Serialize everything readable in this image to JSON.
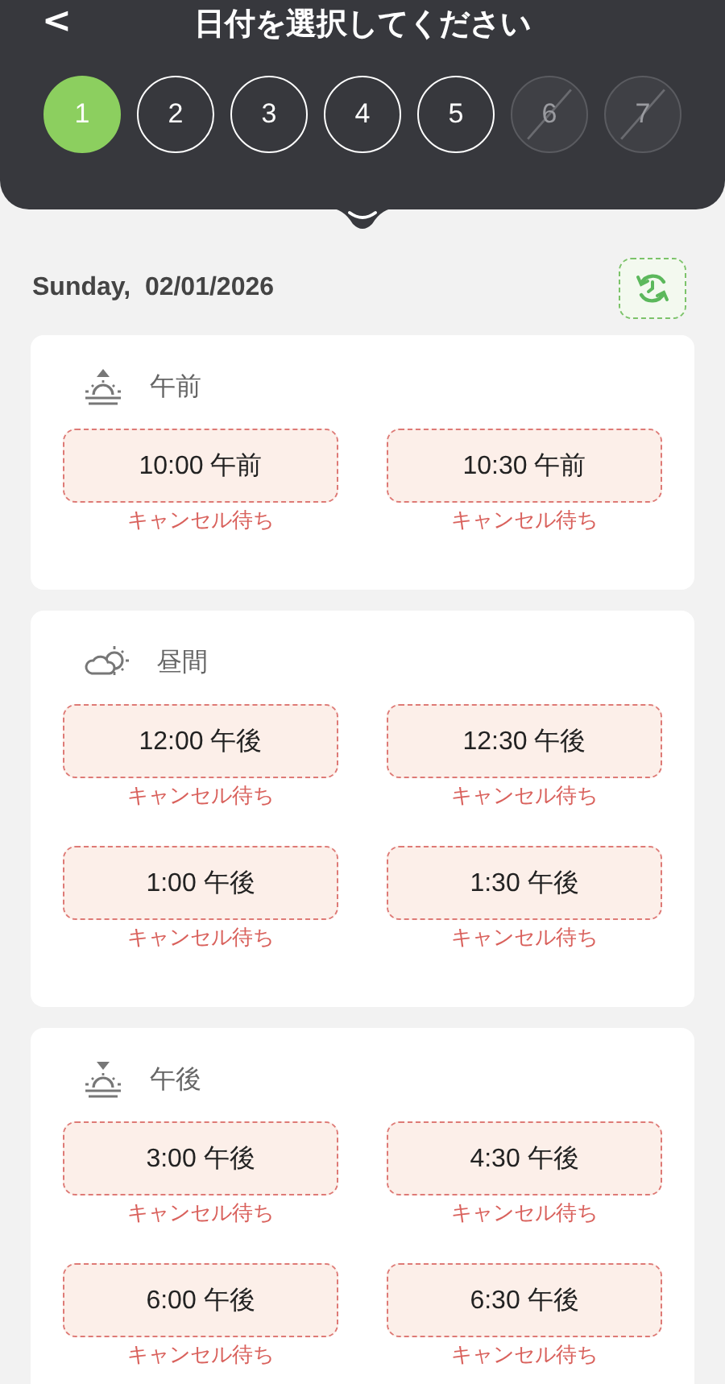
{
  "header": {
    "back": "<",
    "title": "日付を選択してください"
  },
  "days": [
    {
      "label": "1",
      "selected": true,
      "disabled": false
    },
    {
      "label": "2",
      "selected": false,
      "disabled": false
    },
    {
      "label": "3",
      "selected": false,
      "disabled": false
    },
    {
      "label": "4",
      "selected": false,
      "disabled": false
    },
    {
      "label": "5",
      "selected": false,
      "disabled": false
    },
    {
      "label": "6",
      "selected": false,
      "disabled": true
    },
    {
      "label": "7",
      "selected": false,
      "disabled": true
    }
  ],
  "date": "Sunday,  02/01/2026",
  "sections": [
    {
      "kind": "sunrise",
      "title": "午前",
      "slots": [
        {
          "time": "10:00 午前",
          "note": "キャンセル待ち"
        },
        {
          "time": "10:30 午前",
          "note": "キャンセル待ち"
        }
      ]
    },
    {
      "kind": "daytime",
      "title": "昼間",
      "slots": [
        {
          "time": "12:00 午後",
          "note": "キャンセル待ち"
        },
        {
          "time": "12:30 午後",
          "note": "キャンセル待ち"
        },
        {
          "time": "1:00 午後",
          "note": "キャンセル待ち"
        },
        {
          "time": "1:30 午後",
          "note": "キャンセル待ち"
        }
      ]
    },
    {
      "kind": "sunset",
      "title": "午後",
      "slots": [
        {
          "time": "3:00 午後",
          "note": "キャンセル待ち"
        },
        {
          "time": "4:30 午後",
          "note": "キャンセル待ち"
        },
        {
          "time": "6:00 午後",
          "note": "キャンセル待ち"
        },
        {
          "time": "6:30 午後",
          "note": "キャンセル待ち"
        }
      ]
    }
  ]
}
